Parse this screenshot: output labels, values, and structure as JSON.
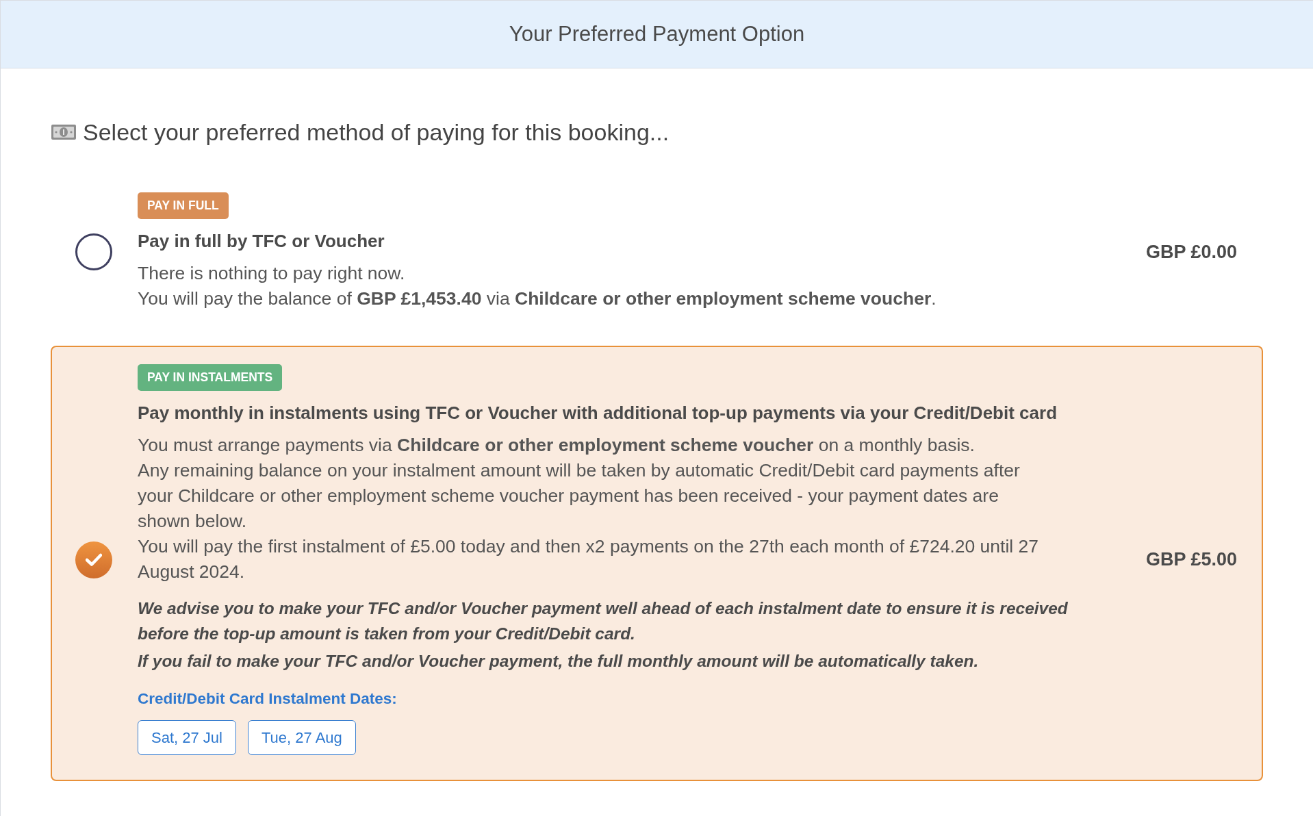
{
  "header": {
    "title": "Your Preferred Payment Option"
  },
  "prompt": "Select your preferred method of paying for this booking...",
  "options": [
    {
      "selected": false,
      "badge": {
        "label": "PAY IN FULL",
        "color": "#d98e57"
      },
      "title": "Pay in full by TFC or Voucher",
      "lines": [
        "There is nothing to pay right now.",
        "You will pay the balance of **GBP £1,453.40** via **Childcare or other employment scheme voucher**."
      ],
      "price": "GBP £0.00"
    },
    {
      "selected": true,
      "badge": {
        "label": "PAY IN INSTALMENTS",
        "color": "#63b380"
      },
      "title": "Pay monthly in instalments using TFC or Voucher with additional top-up payments via your Credit/Debit card",
      "lines": [
        "You must arrange payments via **Childcare or other employment scheme voucher** on a monthly basis.",
        "Any remaining balance on your instalment amount will be taken by automatic Credit/Debit card payments after your Childcare or other employment scheme voucher payment has been received - your payment dates are shown below.",
        "You will pay the first instalment of £5.00 today and then x2 payments on the 27th each month of £724.20 until 27 August 2024."
      ],
      "notes": [
        "We advise you to make your TFC and/or Voucher payment well ahead of each instalment date to ensure it is received before the top-up amount is taken from your Credit/Debit card.",
        "If you fail to make your TFC and/or Voucher payment, the full monthly amount will be automatically taken."
      ],
      "dates_label": "Credit/Debit Card Instalment Dates:",
      "dates": [
        "Sat, 27 Jul",
        "Tue, 27 Aug"
      ],
      "price": "GBP £5.00"
    }
  ]
}
